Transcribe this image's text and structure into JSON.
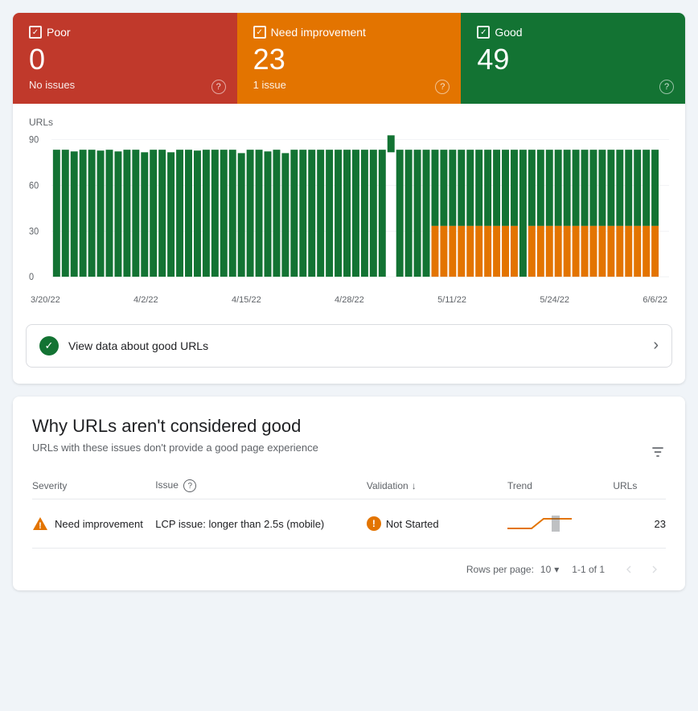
{
  "status": {
    "poor": {
      "label": "Poor",
      "count": "0",
      "issues": "No issues"
    },
    "need_improvement": {
      "label": "Need improvement",
      "count": "23",
      "issues": "1 issue"
    },
    "good": {
      "label": "Good",
      "count": "49",
      "issues": ""
    }
  },
  "chart": {
    "y_label": "URLs",
    "y_max": "90",
    "y_60": "60",
    "y_30": "30",
    "y_0": "0",
    "dates": [
      "3/20/22",
      "4/2/22",
      "4/15/22",
      "4/28/22",
      "5/11/22",
      "5/24/22",
      "6/6/22"
    ]
  },
  "good_urls_link": "View data about good URLs",
  "section": {
    "title": "Why URLs aren't considered good",
    "subtitle": "URLs with these issues don't provide a good page experience"
  },
  "table": {
    "headers": {
      "severity": "Severity",
      "issue": "Issue",
      "validation": "Validation",
      "trend": "Trend",
      "urls": "URLs"
    },
    "rows": [
      {
        "severity": "Need improvement",
        "issue": "LCP issue: longer than 2.5s (mobile)",
        "validation": "Not Started",
        "urls": "23"
      }
    ]
  },
  "pagination": {
    "rows_per_page_label": "Rows per page:",
    "rows_per_page_value": "10",
    "page_range": "1-1 of 1"
  }
}
